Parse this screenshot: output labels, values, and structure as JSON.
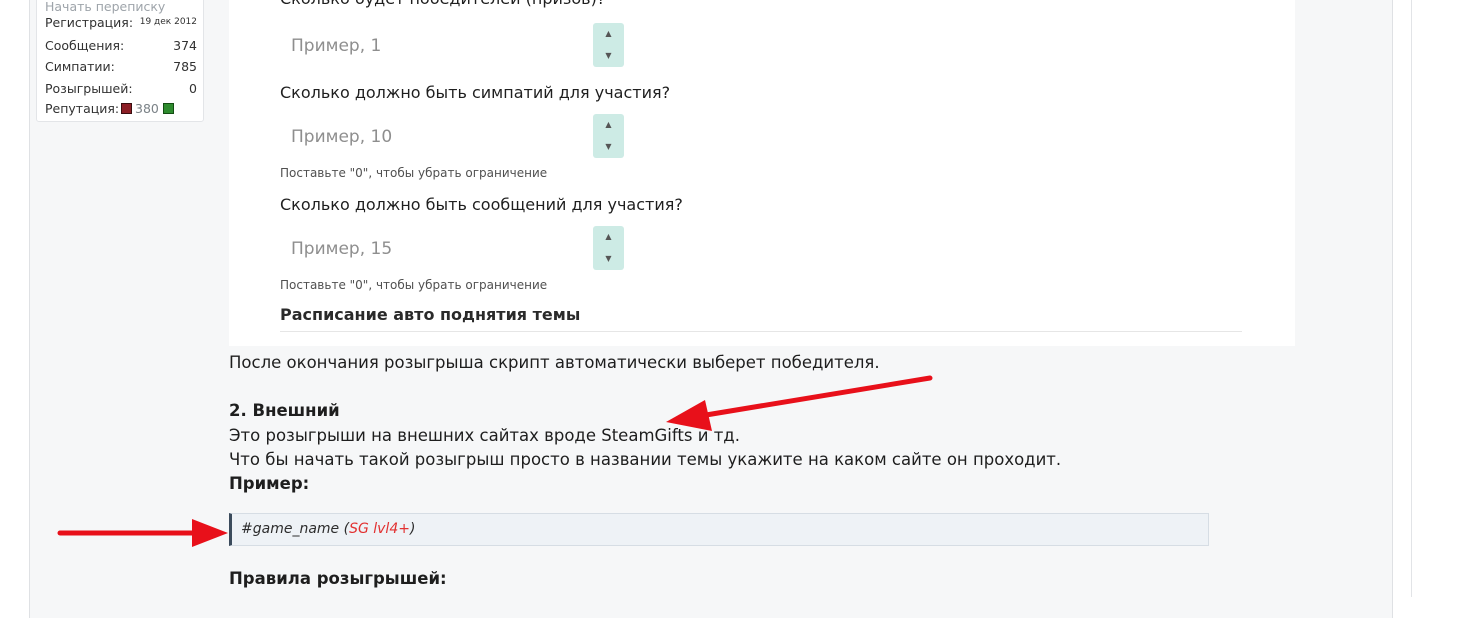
{
  "user_card": {
    "start_conversation": "Начать переписку",
    "rows": [
      {
        "label": "Регистрация:",
        "value": "19 дек 2012"
      },
      {
        "label": "Сообщения:",
        "value": "374"
      },
      {
        "label": "Симпатии:",
        "value": "785"
      },
      {
        "label": "Розыгрышей:",
        "value": "0"
      }
    ],
    "reputation": {
      "label": "Репутация:",
      "value": "380"
    }
  },
  "form": {
    "fields": [
      {
        "label": "Сколько будет победителей (призов)?",
        "placeholder": "Пример, 1",
        "hint": ""
      },
      {
        "label": "Сколько должно быть симпатий для участия?",
        "placeholder": "Пример, 10",
        "hint": "Поставьте \"0\", чтобы убрать ограничение"
      },
      {
        "label": "Сколько должно быть сообщений для участия?",
        "placeholder": "Пример, 15",
        "hint": "Поставьте \"0\", чтобы убрать ограничение"
      }
    ],
    "stepper_up": "▲",
    "stepper_down": "▼",
    "schedule_title": "Расписание авто поднятия темы"
  },
  "post": {
    "after_end": "После окончания розыгрыша скрипт автоматически выберет победителя.",
    "external_heading": "2. Внешний",
    "external_line1": "Это розыгрыши на внешних сайтах вроде SteamGifts и тд.",
    "external_line2": "Что бы начать такой розыгрыш просто в названии темы укажите на каком сайте он проходит.",
    "example_label": "Пример:",
    "code_main": "#game_name (",
    "code_accent": "SG lvl4+",
    "code_end": ")",
    "rules_heading": "Правила розыгрышей:"
  },
  "colors": {
    "arrow": "#e8101a",
    "stepper": "#cdebe5",
    "code_accent": "#e23030"
  }
}
